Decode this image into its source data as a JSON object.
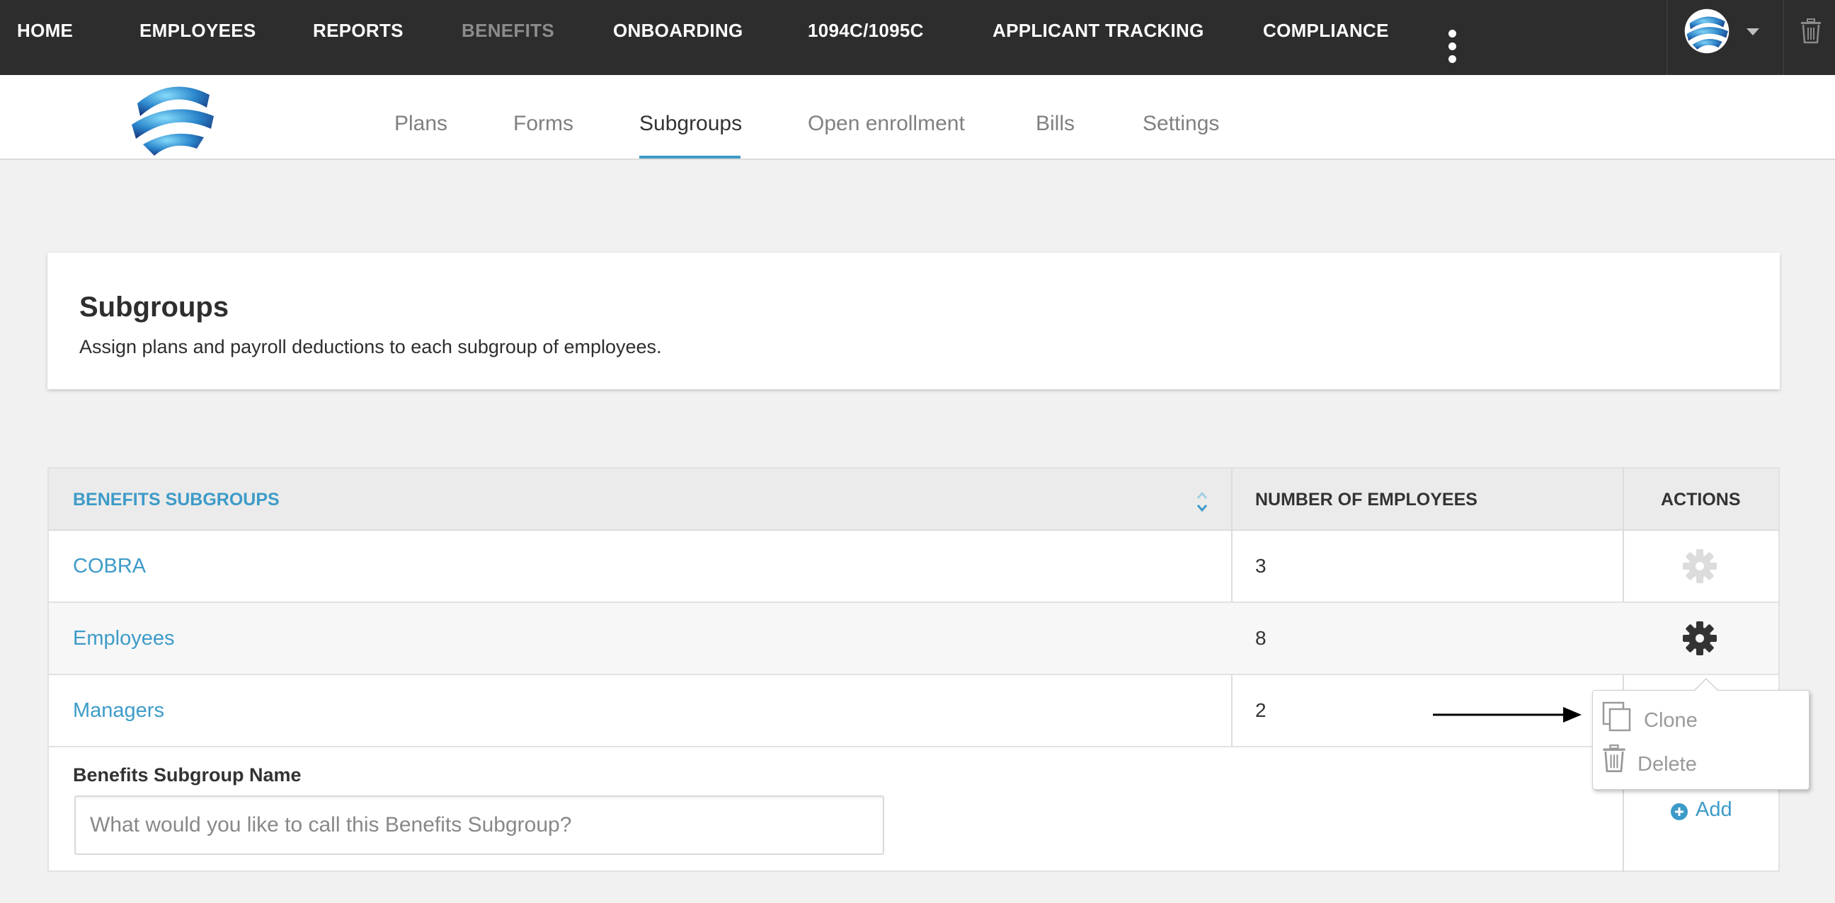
{
  "topnav": {
    "items": [
      {
        "label": "HOME",
        "muted": false
      },
      {
        "label": "EMPLOYEES",
        "muted": false
      },
      {
        "label": "REPORTS",
        "muted": false
      },
      {
        "label": "BENEFITS",
        "muted": true
      },
      {
        "label": "ONBOARDING",
        "muted": false
      },
      {
        "label": "1094C/1095C",
        "muted": false
      },
      {
        "label": "APPLICANT TRACKING",
        "muted": false
      },
      {
        "label": "COMPLIANCE",
        "muted": false
      }
    ],
    "more_icon": "ellipsis-icon",
    "avatar_icon": "globe-logo-icon",
    "dropdown_icon": "caret-down-icon",
    "trash_icon": "trash-icon"
  },
  "subnav": {
    "logo_icon": "globe-logo-icon",
    "tabs": [
      {
        "label": "Plans"
      },
      {
        "label": "Forms"
      },
      {
        "label": "Subgroups",
        "active": true
      },
      {
        "label": "Open enrollment"
      },
      {
        "label": "Bills"
      },
      {
        "label": "Settings"
      }
    ]
  },
  "header": {
    "title": "Subgroups",
    "description": "Assign plans and payroll deductions to each subgroup of employees."
  },
  "table": {
    "columns": {
      "subgroups": "BENEFITS SUBGROUPS",
      "count": "NUMBER OF EMPLOYEES",
      "actions": "ACTIONS"
    },
    "rows": [
      {
        "name": "COBRA",
        "count": "3"
      },
      {
        "name": "Employees",
        "count": "8"
      },
      {
        "name": "Managers",
        "count": "2"
      }
    ],
    "form": {
      "label": "Benefits Subgroup Name",
      "placeholder": "What would you like to call this Benefits Subgroup?",
      "value": "",
      "add_label": "Add"
    }
  },
  "popover": {
    "clone_label": "Clone",
    "delete_label": "Delete"
  },
  "colors": {
    "accent": "#3d9bc8",
    "topnav_bg": "#2d2d2d",
    "page_bg": "#f1f1f1"
  }
}
